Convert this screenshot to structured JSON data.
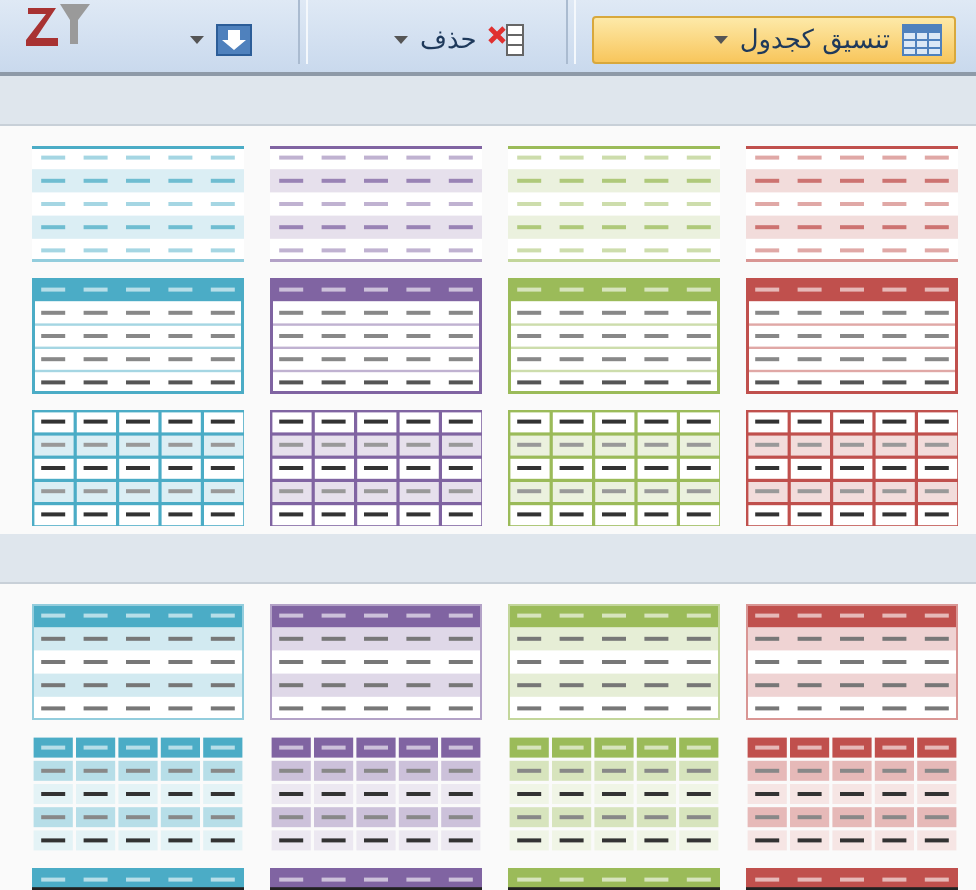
{
  "toolbar": {
    "format_button": {
      "label": "تنسيق كجدول"
    },
    "delete_button": {
      "label": "حذف"
    }
  },
  "sections": [
    {
      "rows": [
        [
          {
            "kind": "light",
            "color": "#4bacc6"
          },
          {
            "kind": "light",
            "color": "#8064a2"
          },
          {
            "kind": "light",
            "color": "#9bbb59"
          },
          {
            "kind": "light",
            "color": "#c0504d"
          }
        ],
        [
          {
            "kind": "header-outline",
            "color": "#4bacc6"
          },
          {
            "kind": "header-outline",
            "color": "#8064a2"
          },
          {
            "kind": "header-outline",
            "color": "#9bbb59"
          },
          {
            "kind": "header-outline",
            "color": "#c0504d"
          }
        ],
        [
          {
            "kind": "grid",
            "color": "#4bacc6"
          },
          {
            "kind": "grid",
            "color": "#8064a2"
          },
          {
            "kind": "grid",
            "color": "#9bbb59"
          },
          {
            "kind": "grid",
            "color": "#c0504d"
          }
        ]
      ]
    },
    {
      "rows": [
        [
          {
            "kind": "header-banded",
            "color": "#4bacc6"
          },
          {
            "kind": "header-banded",
            "color": "#8064a2"
          },
          {
            "kind": "header-banded",
            "color": "#9bbb59"
          },
          {
            "kind": "header-banded",
            "color": "#c0504d"
          }
        ],
        [
          {
            "kind": "header-columns",
            "color": "#4bacc6"
          },
          {
            "kind": "header-columns",
            "color": "#8064a2"
          },
          {
            "kind": "header-columns",
            "color": "#9bbb59"
          },
          {
            "kind": "header-columns",
            "color": "#c0504d"
          }
        ],
        [
          {
            "kind": "dark-header",
            "color": "#4bacc6"
          },
          {
            "kind": "dark-header",
            "color": "#8064a2"
          },
          {
            "kind": "dark-header",
            "color": "#9bbb59"
          },
          {
            "kind": "dark-header",
            "color": "#c0504d"
          }
        ]
      ]
    }
  ]
}
